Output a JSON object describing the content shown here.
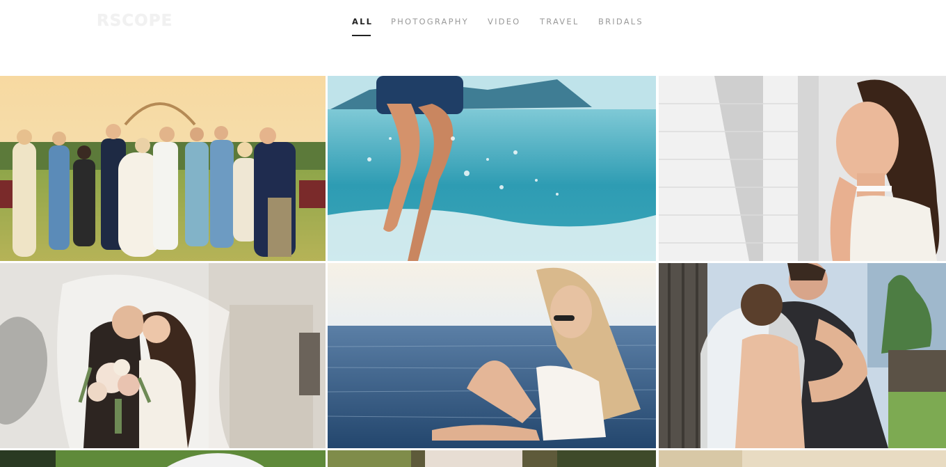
{
  "brand": {
    "logo_text": "RSCOPE"
  },
  "nav": {
    "items": [
      {
        "label": "ALL",
        "active": true
      },
      {
        "label": "PHOTOGRAPHY",
        "active": false
      },
      {
        "label": "VIDEO",
        "active": false
      },
      {
        "label": "TRAVEL",
        "active": false
      },
      {
        "label": "BRIDALS",
        "active": false
      }
    ]
  },
  "gallery": {
    "tiles": [
      {
        "subject": "wedding-party-in-vineyard"
      },
      {
        "subject": "legs-splashing-in-sea"
      },
      {
        "subject": "woman-portrait-by-wall"
      },
      {
        "subject": "couple-kissing-under-veil"
      },
      {
        "subject": "woman-sitting-in-sea"
      },
      {
        "subject": "bride-and-groom-embracing"
      },
      {
        "subject": "bride-on-grass"
      },
      {
        "subject": "bride-in-lace-dress"
      },
      {
        "subject": "sunlit-scene"
      }
    ]
  },
  "colors": {
    "active_nav": "#222222",
    "inactive_nav": "#9a9a9a",
    "background": "#ffffff"
  }
}
